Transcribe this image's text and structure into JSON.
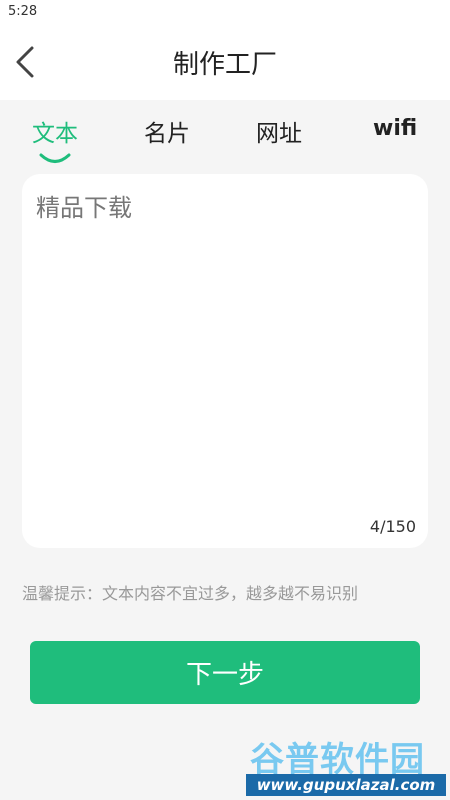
{
  "status_bar": {
    "time": "5:28"
  },
  "header": {
    "title": "制作工厂",
    "back_icon": "chevron-left-icon"
  },
  "tabs": [
    {
      "label": "文本",
      "active": true
    },
    {
      "label": "名片",
      "active": false
    },
    {
      "label": "网址",
      "active": false
    },
    {
      "label": "wifi",
      "active": false
    }
  ],
  "editor": {
    "value": "精品下载",
    "counter": "4/150"
  },
  "tip": "温馨提示：文本内容不宜过多，越多越不易识别",
  "next_button": {
    "label": "下一步"
  },
  "watermark": {
    "logo_text": "谷普软件园",
    "url_text": "www.gupuxlazal.com"
  },
  "colors": {
    "accent": "#1fbd7c",
    "background": "#f5f5f5",
    "watermark_blue": "#1b6aa8"
  }
}
